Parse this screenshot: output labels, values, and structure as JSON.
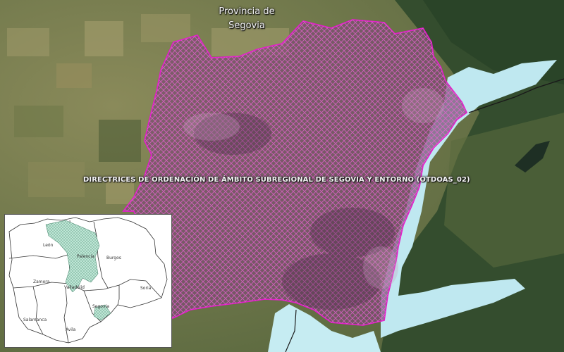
{
  "map": {
    "province_label": "Provincia de Segovia",
    "zone_label": "DIRECTRICES DE ORDENACIÓN DE ÁMBITO SUBREGIONAL DE SEGOVIA Y ENTORNO (OTDOAS_02)",
    "colors": {
      "zone_outline": "#e020c8",
      "zone_hatch": "#ee60d8",
      "water": "#bfe8f0",
      "forest": "#2e4a2a",
      "fields": "#7a7e4a"
    }
  },
  "inset": {
    "provinces": [
      "León",
      "Palencia",
      "Burgos",
      "Zamora",
      "Valladolid",
      "Soria",
      "Segovia",
      "Salamanca",
      "Ávila"
    ],
    "highlight_color": "#bfe6d6"
  }
}
